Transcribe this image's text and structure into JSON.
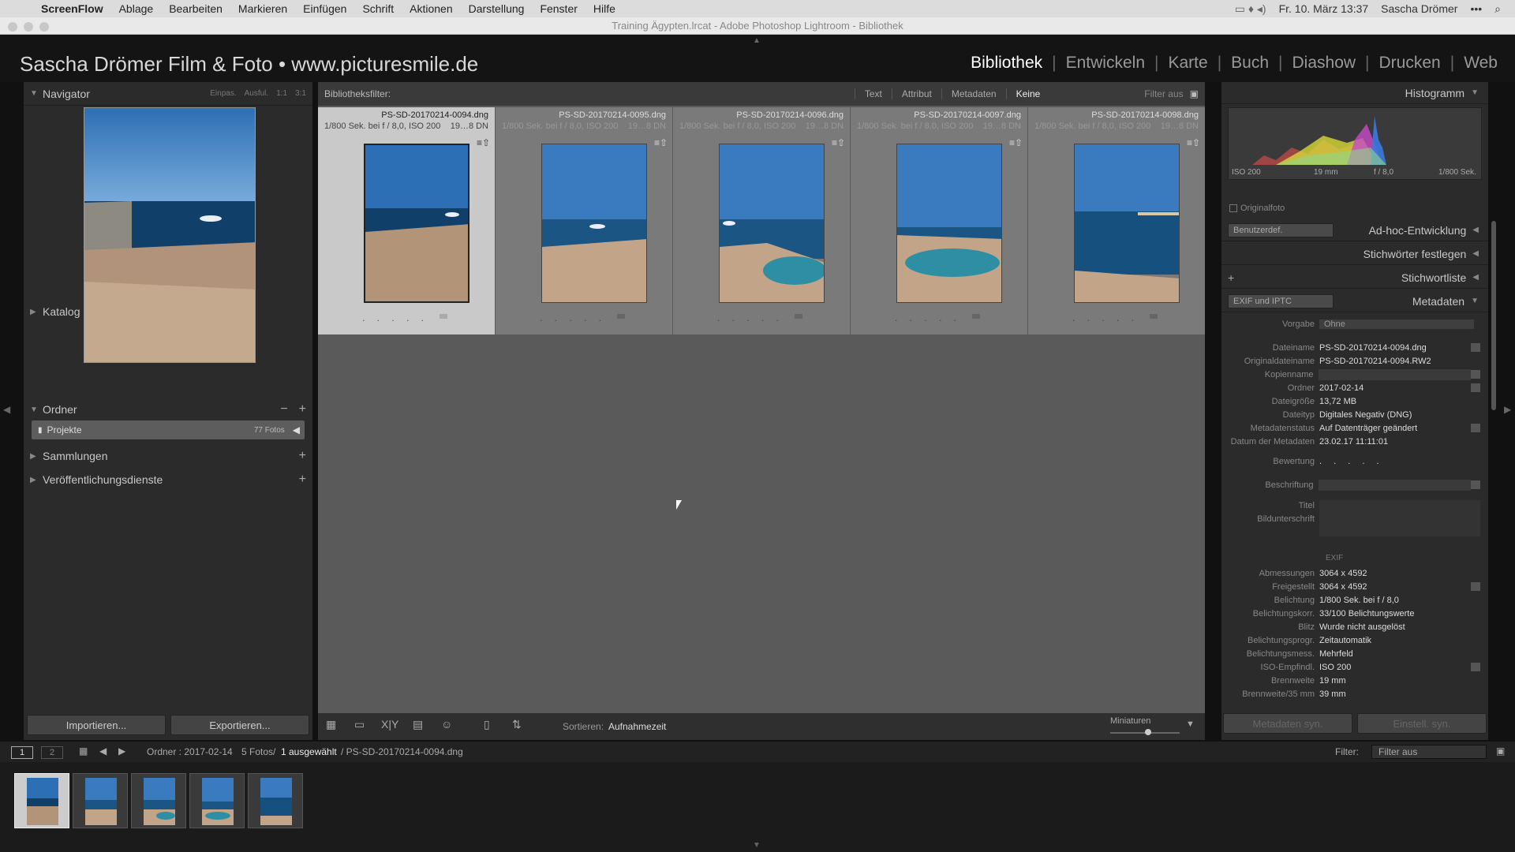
{
  "menubar": {
    "apple": "",
    "items": [
      "ScreenFlow",
      "Ablage",
      "Bearbeiten",
      "Markieren",
      "Einfügen",
      "Schrift",
      "Aktionen",
      "Darstellung",
      "Fenster",
      "Hilfe"
    ],
    "datetime": "Fr. 10. März  13:37",
    "user": "Sascha Drömer"
  },
  "window": {
    "title": "Training Ägypten.lrcat - Adobe Photoshop Lightroom - Bibliothek"
  },
  "identity": {
    "plate": "Sascha Drömer Film & Foto • www.picturesmile.de",
    "modules": [
      "Bibliothek",
      "Entwickeln",
      "Karte",
      "Buch",
      "Diashow",
      "Drucken",
      "Web"
    ],
    "active_module": "Bibliothek"
  },
  "left": {
    "navigator": {
      "title": "Navigator",
      "controls": [
        "Einpas.",
        "Ausful.",
        "1:1",
        "3:1"
      ]
    },
    "sections": {
      "katalog": "Katalog",
      "ordner": "Ordner",
      "sammlungen": "Sammlungen",
      "veroeffentlichung": "Veröffentlichungsdienste"
    },
    "folder": {
      "name": "Projekte",
      "count": "77 Fotos"
    },
    "import_label": "Importieren...",
    "export_label": "Exportieren..."
  },
  "filterbar": {
    "label": "Bibliotheksfilter:",
    "options": [
      "Text",
      "Attribut",
      "Metadaten",
      "Keine"
    ],
    "active": "Keine",
    "right": "Filter aus"
  },
  "grid": {
    "cells": [
      {
        "name": "PS-SD-20170214-0094.dng",
        "exposure": "1/800 Sek. bei f / 8,0, ISO 200",
        "extra": "19…8 DN",
        "selected": true
      },
      {
        "name": "PS-SD-20170214-0095.dng",
        "exposure": "1/800 Sek. bei f / 8,0, ISO 200",
        "extra": "19…8 DN",
        "selected": false
      },
      {
        "name": "PS-SD-20170214-0096.dng",
        "exposure": "1/800 Sek. bei f / 8,0, ISO 200",
        "extra": "19…8 DN",
        "selected": false
      },
      {
        "name": "PS-SD-20170214-0097.dng",
        "exposure": "1/800 Sek. bei f / 8,0, ISO 200",
        "extra": "19…8 DN",
        "selected": false
      },
      {
        "name": "PS-SD-20170214-0098.dng",
        "exposure": "1/800 Sek. bei f / 8,0, ISO 200",
        "extra": "19…8 DN",
        "selected": false
      }
    ],
    "stars": ". . . . ."
  },
  "toolbar": {
    "sort_label": "Sortieren:",
    "sort_value": "Aufnahmezeit",
    "miniaturen": "Miniaturen"
  },
  "right": {
    "histogram": {
      "title": "Histogramm",
      "iso": "ISO 200",
      "focal": "19 mm",
      "aperture": "f / 8,0",
      "shutter": "1/800 Sek.",
      "original_label": "Originalfoto"
    },
    "quickdev": {
      "preset": "Benutzerdef.",
      "title": "Ad-hoc-Entwicklung"
    },
    "keywords_set": "Stichwörter festlegen",
    "keyword_list": "Stichwortliste",
    "metadata": {
      "preset": "EXIF und IPTC",
      "title": "Metadaten",
      "vorgabe_label": "Vorgabe",
      "vorgabe_value": "Ohne",
      "rows": [
        {
          "k": "Dateiname",
          "v": "PS-SD-20170214-0094.dng"
        },
        {
          "k": "Originaldateiname",
          "v": "PS-SD-20170214-0094.RW2"
        },
        {
          "k": "Kopienname",
          "v": ""
        },
        {
          "k": "Ordner",
          "v": "2017-02-14"
        },
        {
          "k": "Dateigröße",
          "v": "13,72 MB"
        },
        {
          "k": "Dateityp",
          "v": "Digitales Negativ (DNG)"
        },
        {
          "k": "Metadatenstatus",
          "v": "Auf Datenträger geändert"
        },
        {
          "k": "Datum der Metadaten",
          "v": "23.02.17 11:11:01"
        }
      ],
      "bewertung": "Bewertung",
      "beschriftung": "Beschriftung",
      "titel": "Titel",
      "bildunterschrift": "Bildunterschrift",
      "exif_label": "EXIF",
      "exif_rows": [
        {
          "k": "Abmessungen",
          "v": "3064 x 4592"
        },
        {
          "k": "Freigestellt",
          "v": "3064 x 4592"
        },
        {
          "k": "Belichtung",
          "v": "1/800 Sek. bei f / 8,0"
        },
        {
          "k": "Belichtungskorr.",
          "v": "33/100 Belichtungswerte"
        },
        {
          "k": "Blitz",
          "v": "Wurde nicht ausgelöst"
        },
        {
          "k": "Belichtungsprogr.",
          "v": "Zeitautomatik"
        },
        {
          "k": "Belichtungsmess.",
          "v": "Mehrfeld"
        },
        {
          "k": "ISO-Empfindl.",
          "v": "ISO 200"
        },
        {
          "k": "Brennweite",
          "v": "19 mm"
        },
        {
          "k": "Brennweite/35 mm",
          "v": "39 mm"
        }
      ]
    },
    "sync_meta": "Metadaten syn.",
    "sync_settings": "Einstell. syn."
  },
  "filmstrip": {
    "page1": "1",
    "page2": "2",
    "path": "Ordner : 2017-02-14",
    "count": "5 Fotos/",
    "selected": "1 ausgewählt",
    "file": "/ PS-SD-20170214-0094.dng",
    "filter_label": "Filter:",
    "filter_value": "Filter aus"
  }
}
